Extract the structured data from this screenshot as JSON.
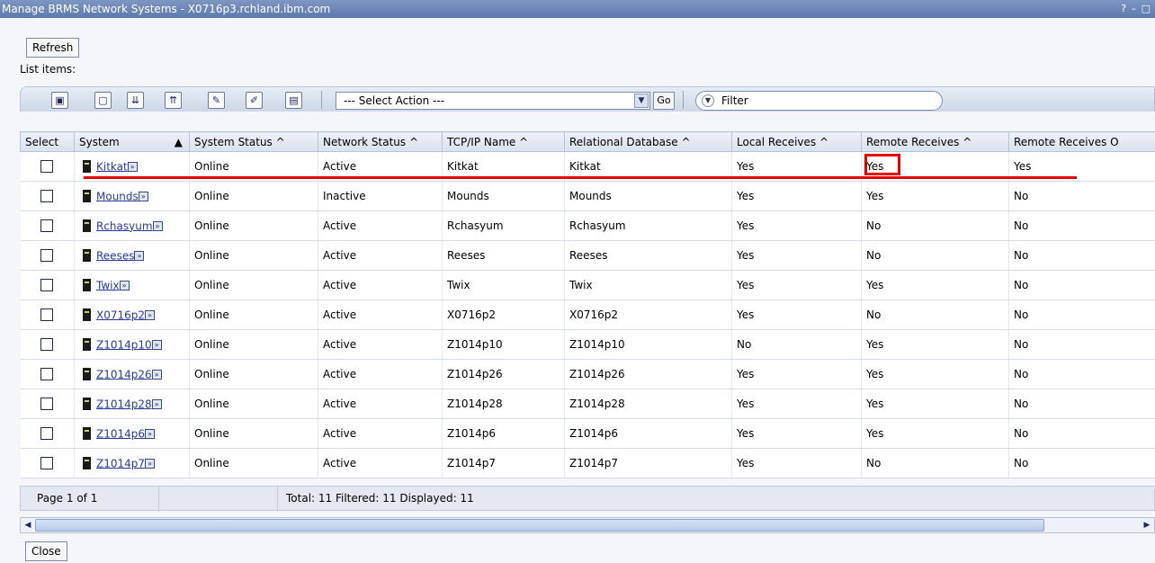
{
  "window": {
    "title": "Manage BRMS Network Systems - X0716p3.rchland.ibm.com",
    "controls": "? – □"
  },
  "buttons": {
    "refresh": "Refresh",
    "close": "Close",
    "go": "Go"
  },
  "list_label": "List items:",
  "toolbar": {
    "icons": [
      "select-all-icon",
      "deselect-all-icon",
      "expand-icon",
      "collapse-icon",
      "edit-sort-icon",
      "clear-sort-icon",
      "column-config-icon"
    ],
    "action_select": "--- Select Action ---",
    "filter_placeholder": "Filter"
  },
  "columns": [
    "Select",
    "System",
    "System Status",
    "Network Status",
    "TCP/IP Name",
    "Relational Database",
    "Local Receives",
    "Remote Receives",
    "Remote Receives O"
  ],
  "rows": [
    {
      "system": "Kitkat",
      "status": "Online",
      "network": "Active",
      "tcpip": "Kitkat",
      "rdb": "Kitkat",
      "local": "Yes",
      "remote": "Yes",
      "remote_o": "Yes"
    },
    {
      "system": "Mounds",
      "status": "Online",
      "network": "Inactive",
      "tcpip": "Mounds",
      "rdb": "Mounds",
      "local": "Yes",
      "remote": "Yes",
      "remote_o": "No"
    },
    {
      "system": "Rchasyum",
      "status": "Online",
      "network": "Active",
      "tcpip": "Rchasyum",
      "rdb": "Rchasyum",
      "local": "Yes",
      "remote": "No",
      "remote_o": "No"
    },
    {
      "system": "Reeses",
      "status": "Online",
      "network": "Active",
      "tcpip": "Reeses",
      "rdb": "Reeses",
      "local": "Yes",
      "remote": "No",
      "remote_o": "No"
    },
    {
      "system": "Twix",
      "status": "Online",
      "network": "Active",
      "tcpip": "Twix",
      "rdb": "Twix",
      "local": "Yes",
      "remote": "Yes",
      "remote_o": "No"
    },
    {
      "system": "X0716p2",
      "status": "Online",
      "network": "Active",
      "tcpip": "X0716p2",
      "rdb": "X0716p2",
      "local": "Yes",
      "remote": "No",
      "remote_o": "No"
    },
    {
      "system": "Z1014p10",
      "status": "Online",
      "network": "Active",
      "tcpip": "Z1014p10",
      "rdb": "Z1014p10",
      "local": "No",
      "remote": "Yes",
      "remote_o": "No"
    },
    {
      "system": "Z1014p26",
      "status": "Online",
      "network": "Active",
      "tcpip": "Z1014p26",
      "rdb": "Z1014p26",
      "local": "Yes",
      "remote": "Yes",
      "remote_o": "No"
    },
    {
      "system": "Z1014p28",
      "status": "Online",
      "network": "Active",
      "tcpip": "Z1014p28",
      "rdb": "Z1014p28",
      "local": "Yes",
      "remote": "Yes",
      "remote_o": "No"
    },
    {
      "system": "Z1014p6",
      "status": "Online",
      "network": "Active",
      "tcpip": "Z1014p6",
      "rdb": "Z1014p6",
      "local": "Yes",
      "remote": "Yes",
      "remote_o": "No"
    },
    {
      "system": "Z1014p7",
      "status": "Online",
      "network": "Active",
      "tcpip": "Z1014p7",
      "rdb": "Z1014p7",
      "local": "Yes",
      "remote": "No",
      "remote_o": "No"
    }
  ],
  "footer": {
    "page": "Page 1 of 1",
    "totals": "Total: 11   Filtered: 11   Displayed: 11"
  },
  "colors": {
    "highlight": "#e60000",
    "titlebar": "#5d79ad",
    "link": "#2a3a9a"
  }
}
